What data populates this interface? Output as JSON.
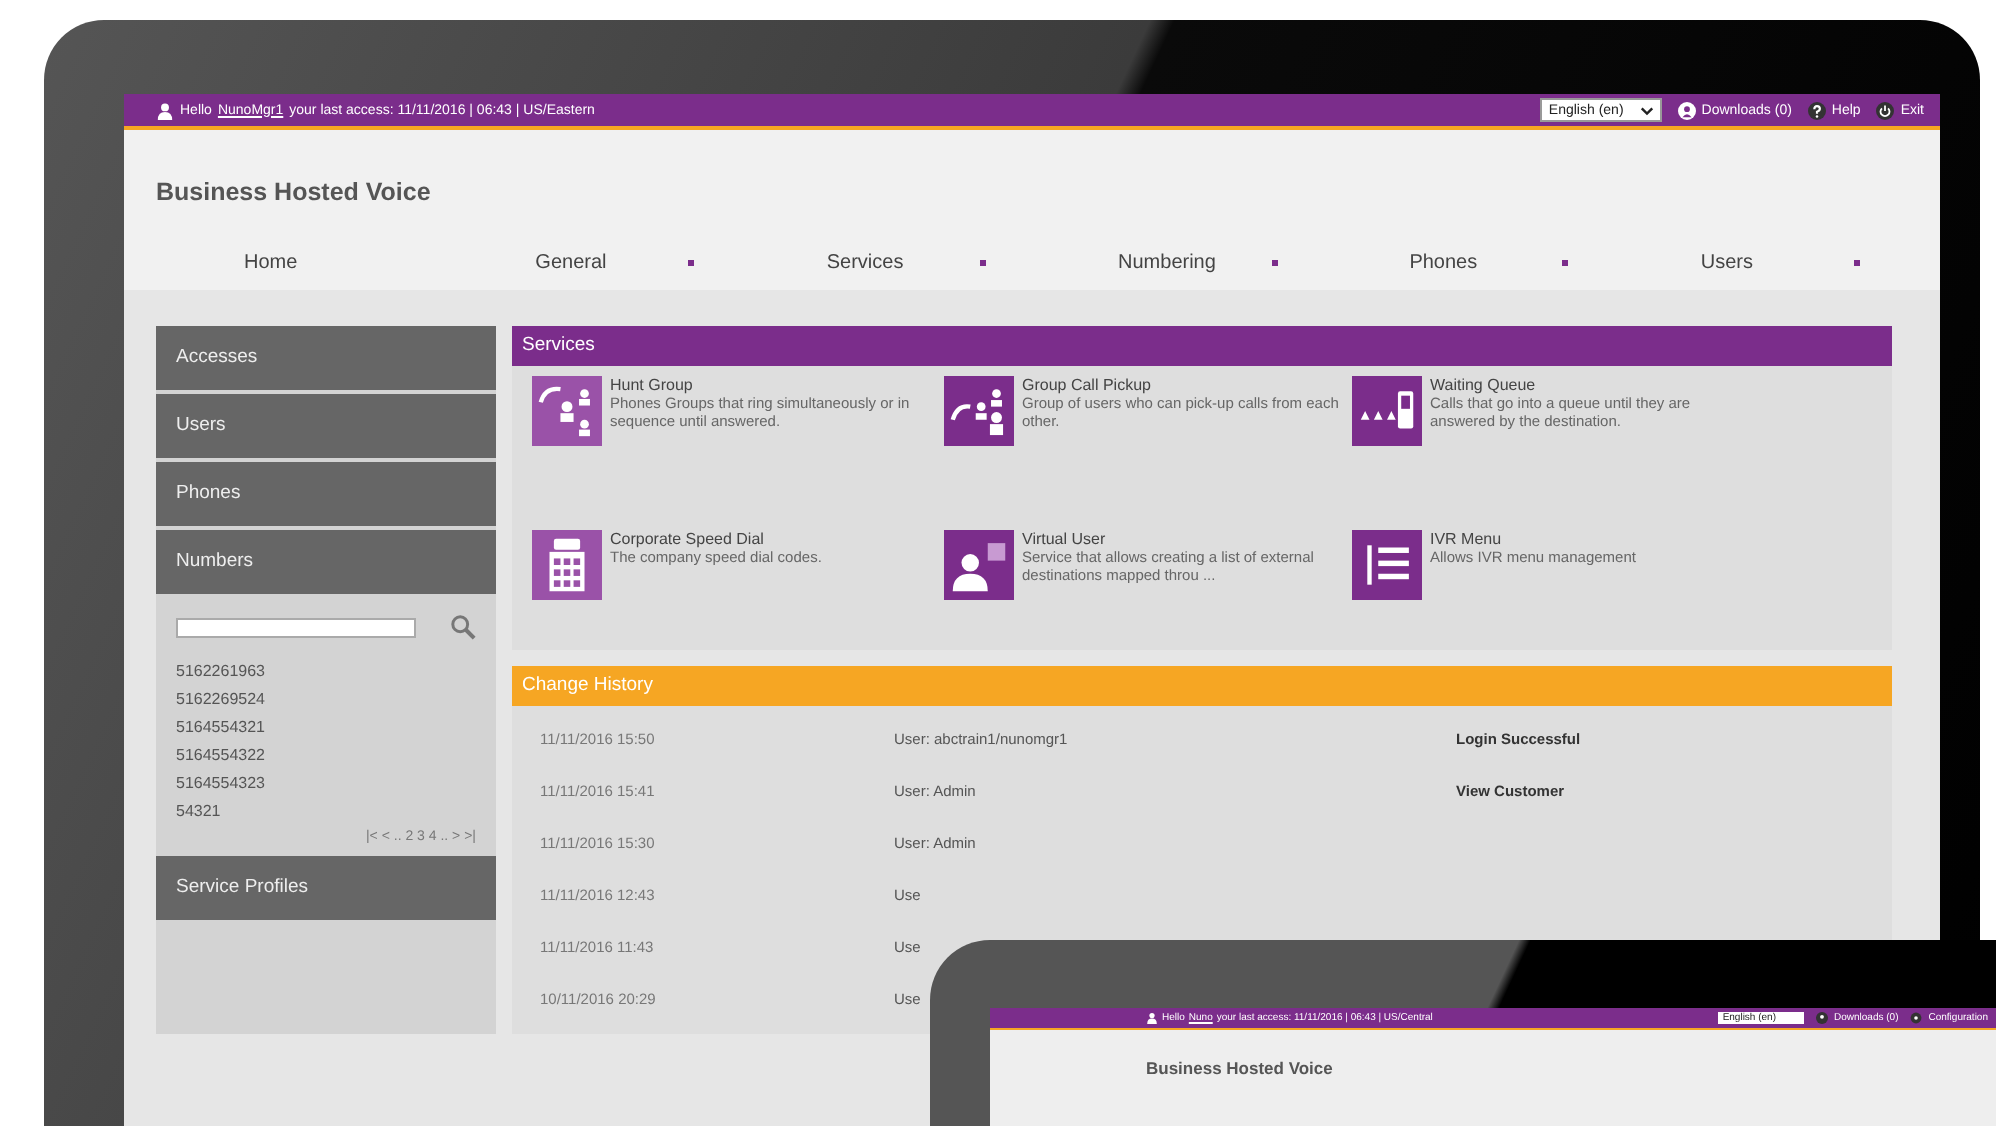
{
  "top_bar": {
    "greeting": "Hello",
    "user_link": "NunoMgr1",
    "last_access": "your last access: 11/11/2016 | 06:43 | US/Eastern",
    "language": "English (en)",
    "links": [
      {
        "kind": "downloads",
        "label": "Downloads (0)"
      },
      {
        "kind": "help",
        "label": "Help"
      },
      {
        "kind": "exit",
        "label": "Exit"
      }
    ]
  },
  "app_title": "Business Hosted Voice",
  "nav": [
    {
      "label": "Home",
      "dropdown": false
    },
    {
      "label": "General",
      "dropdown": true
    },
    {
      "label": "Services",
      "dropdown": true
    },
    {
      "label": "Numbering",
      "dropdown": true
    },
    {
      "label": "Phones",
      "dropdown": true
    },
    {
      "label": "Users",
      "dropdown": true
    }
  ],
  "sidebar": {
    "items": [
      {
        "label": "Accesses"
      },
      {
        "label": "Users"
      },
      {
        "label": "Phones"
      },
      {
        "label": "Numbers"
      }
    ],
    "numbers": [
      "5162261963",
      "5162269524",
      "5164554321",
      "5164554322",
      "5164554323",
      "54321"
    ],
    "pager": "|< < .. 2 3 4 .. > >|",
    "footer_item": "Service Profiles"
  },
  "services": {
    "title": "Services",
    "cards": [
      {
        "kind": "hunt",
        "name": "Hunt Group",
        "description": "Phones Groups that ring simultaneously or in sequence until answered."
      },
      {
        "kind": "pickup",
        "name": "Group Call Pickup",
        "description": "Group of users who can pick-up calls from each other."
      },
      {
        "kind": "queue",
        "name": "Waiting Queue",
        "description": "Calls that go into a queue until they are answered by the destination."
      },
      {
        "kind": "speeddial",
        "name": "Corporate Speed Dial",
        "description": "The company speed dial codes."
      },
      {
        "kind": "virtual",
        "name": "Virtual User",
        "description": "Service that allows creating a list of external destinations mapped throu ..."
      },
      {
        "kind": "ivr",
        "name": "IVR Menu",
        "description": "Allows IVR menu management"
      }
    ]
  },
  "change_history": {
    "title": "Change History",
    "rows": [
      {
        "time": "11/11/2016 15:50",
        "user": "User: abctrain1/nunomgr1",
        "action": "Login Successful"
      },
      {
        "time": "11/11/2016 15:41",
        "user": "User: Admin",
        "action": "View Customer"
      },
      {
        "time": "11/11/2016 15:30",
        "user": "User: Admin"
      },
      {
        "time": "11/11/2016 12:43",
        "user": "Use"
      },
      {
        "time": "11/11/2016 11:43",
        "user": "Use"
      },
      {
        "time": "10/11/2016 20:29",
        "user": "Use"
      }
    ]
  },
  "tablet": {
    "greeting": "Hello",
    "user_link": "Nuno",
    "last_access": "your last access: 11/11/2016 | 06:43 | US/Central",
    "language": "English (en)",
    "links": [
      {
        "kind": "downloads",
        "label": "Downloads (0)"
      },
      {
        "kind": "settings",
        "label": "Configuration"
      }
    ],
    "app_title": "Business Hosted Voice"
  }
}
